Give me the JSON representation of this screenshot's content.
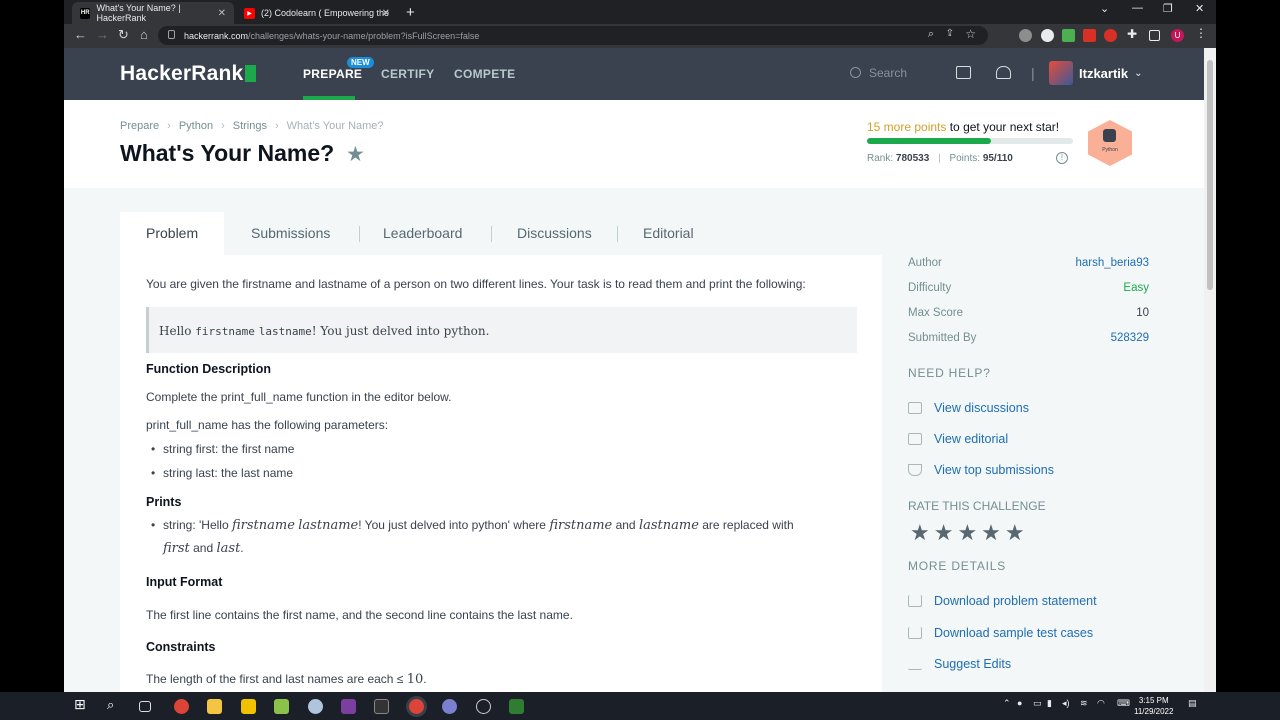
{
  "browser": {
    "tabs": [
      {
        "title": "What's Your Name? | HackerRank",
        "favicon": "HR"
      },
      {
        "title": "(2) Codolearn ( Empowering the",
        "favicon": "YT"
      }
    ],
    "url_domain": "hackerrank.com",
    "url_path": "/challenges/whats-your-name/problem?isFullScreen=false",
    "profile_initial": "U"
  },
  "nav": {
    "logo": "HackerRank",
    "links": [
      {
        "label": "PREPARE"
      },
      {
        "label": "CERTIFY"
      },
      {
        "label": "COMPETE"
      }
    ],
    "new_badge": "NEW",
    "search_placeholder": "Search",
    "username": "Itzkartik"
  },
  "header": {
    "breadcrumbs": [
      "Prepare",
      "Python",
      "Strings",
      "What's Your Name?"
    ],
    "title": "What's Your Name?",
    "points_highlight": "15 more points",
    "points_rest": " to get your next star!",
    "progress": 0.6,
    "rank_label": "Rank:",
    "rank_value": "780533",
    "points_label": "Points:",
    "points_value": "95/110",
    "badge_label": "Python"
  },
  "tabs": [
    "Problem",
    "Submissions",
    "Leaderboard",
    "Discussions",
    "Editorial"
  ],
  "problem": {
    "intro": "You are given the firstname and lastname of a person on two different lines. Your task is to read them and print the following:",
    "quote_pre": "Hello ",
    "quote_first": "firstname",
    "quote_last": "lastname",
    "quote_post": "! You just delved into python.",
    "func_heading": "Function Description",
    "func_text": "Complete the print_full_name function in the editor below.",
    "params_text": "print_full_name has the following parameters:",
    "params": [
      "string first: the first name",
      "string last: the last name"
    ],
    "prints_heading": "Prints",
    "prints_a": "string: 'Hello ",
    "prints_first": "firstname",
    "prints_last": "lastname",
    "prints_b": "! You just delved into python' where ",
    "prints_and": " and ",
    "prints_c": " are replaced with",
    "prints_m1": "first",
    "prints_m2": "last",
    "input_heading": "Input Format",
    "input_text": "The first line contains the first name, and the second line contains the last name.",
    "constraints_heading": "Constraints",
    "constraints_text": "The length of the first and last names are each ≤ ",
    "constraints_num": "10"
  },
  "sidebar": {
    "details": [
      {
        "label": "Author",
        "value": "harsh_beria93"
      },
      {
        "label": "Difficulty",
        "value": "Easy"
      },
      {
        "label": "Max Score",
        "value": "10"
      },
      {
        "label": "Submitted By",
        "value": "528329"
      }
    ],
    "need_help": "NEED HELP?",
    "help_links": [
      "View discussions",
      "View editorial",
      "View top submissions"
    ],
    "rate": "RATE THIS CHALLENGE",
    "more": "MORE DETAILS",
    "more_links": [
      "Download problem statement",
      "Download sample test cases",
      "Suggest Edits"
    ]
  },
  "taskbar": {
    "time": "3:15 PM",
    "date": "11/29/2022"
  }
}
